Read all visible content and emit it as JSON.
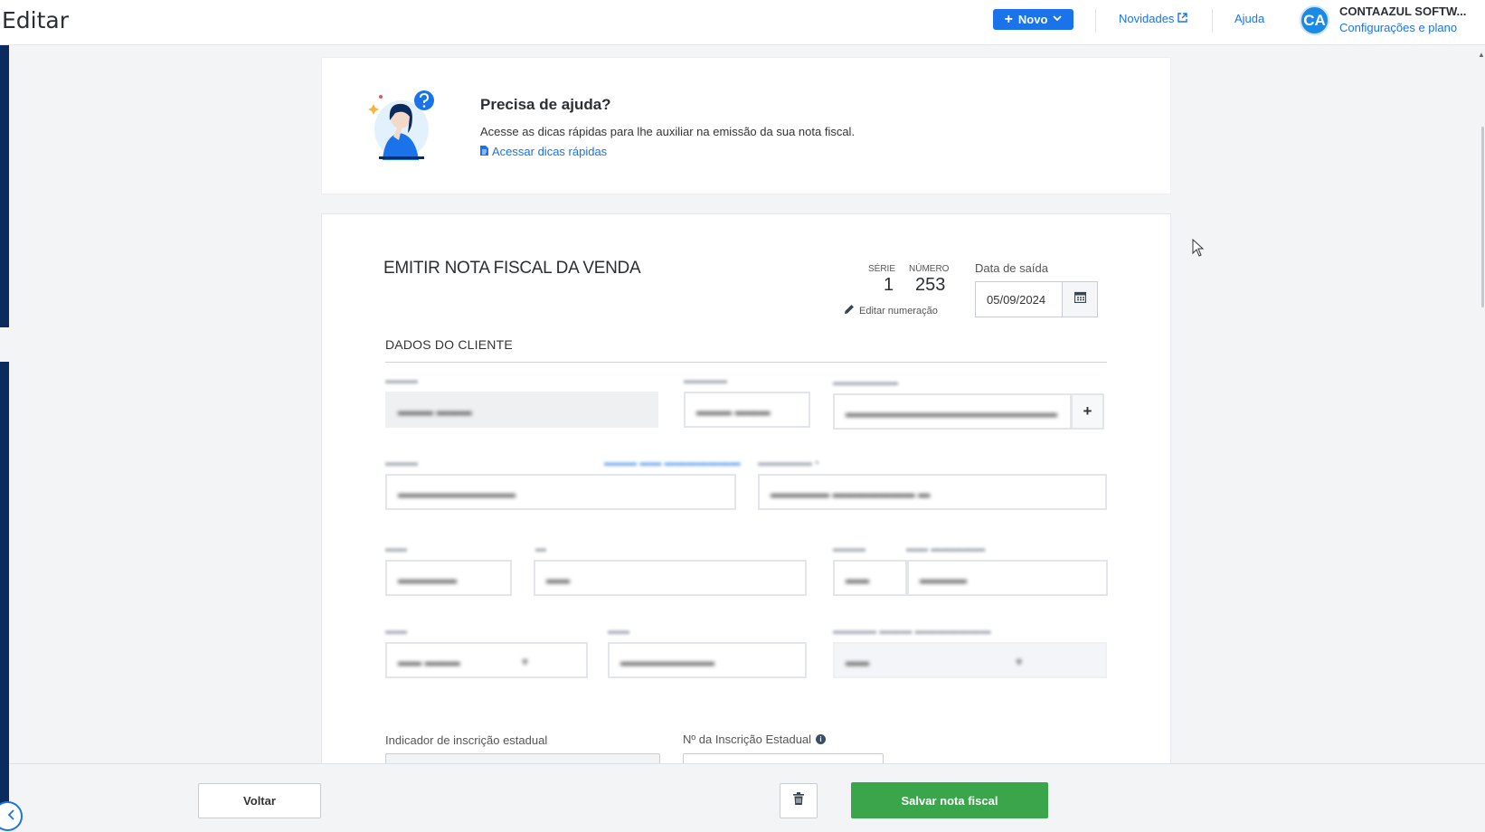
{
  "header": {
    "page_title": "Editar",
    "new_button": "Novo",
    "news_link": "Novidades",
    "help_link": "Ajuda",
    "avatar_initials": "CA",
    "company_name": "CONTAAZUL SOFTW...",
    "company_sub": "Configurações e plano"
  },
  "help_card": {
    "title": "Precisa de ajuda?",
    "text": "Acesse as dicas rápidas para lhe auxiliar na emissão da sua nota fiscal.",
    "link": "Acessar dicas rápidas"
  },
  "invoice": {
    "title": "EMITIR NOTA FISCAL DA VENDA",
    "serie_label": "SÉRIE",
    "serie_value": "1",
    "numero_label": "NÚMERO",
    "numero_value": "253",
    "edit_numbering": "Editar numeração",
    "date_label": "Data de saída",
    "date_value": "05/09/2024"
  },
  "client_section": {
    "title": "DADOS DO CLIENTE",
    "state_indicator_label": "Indicador de inscrição estadual",
    "state_registration_label": "Nº da Inscrição Estadual"
  },
  "footer": {
    "back_button": "Voltar",
    "save_button": "Salvar nota fiscal"
  },
  "colors": {
    "primary": "#1a73e8",
    "sidebar": "#0b2a5e",
    "save_green": "#3aa54a"
  }
}
